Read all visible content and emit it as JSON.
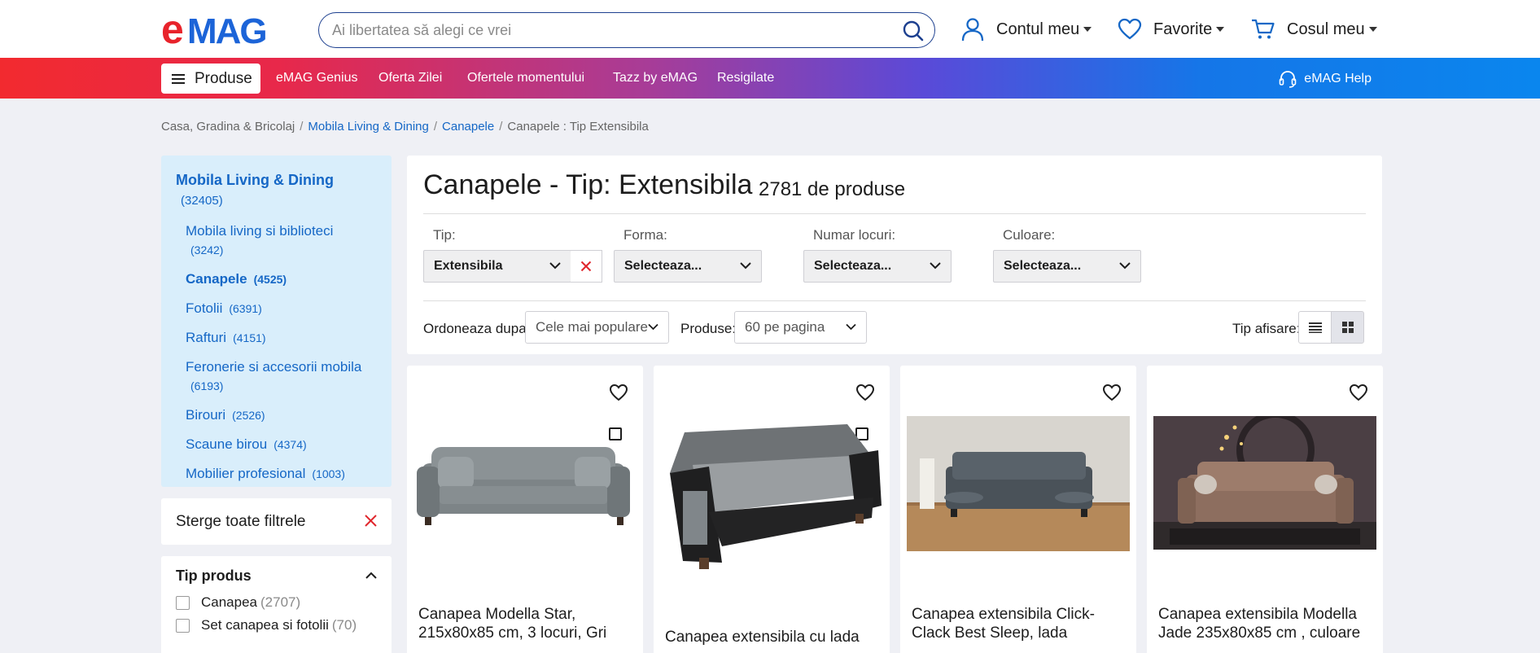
{
  "header": {
    "logo_text": "eMAG",
    "search_placeholder": "Ai libertatea să alegi ce vrei",
    "account_label": "Contul meu",
    "favorites_label": "Favorite",
    "cart_label": "Cosul meu"
  },
  "nav": {
    "products_label": "Produse",
    "links": [
      "eMAG Genius",
      "Oferta Zilei",
      "Ofertele momentului",
      "Tazz by eMAG",
      "Resigilate"
    ],
    "help_label": "eMAG Help"
  },
  "breadcrumb": {
    "items": [
      "Casa, Gradina & Bricolaj",
      "Mobila Living & Dining",
      "Canapele",
      "Canapele : Tip Extensibila"
    ],
    "separator": "/"
  },
  "sidebar": {
    "main_category": "Mobila Living & Dining",
    "main_count": "(32405)",
    "categories": [
      {
        "label": "Mobila living si biblioteci",
        "count": "(3242)"
      },
      {
        "label": "Canapele",
        "count": "(4525)"
      },
      {
        "label": "Fotolii",
        "count": "(6391)"
      },
      {
        "label": "Rafturi",
        "count": "(4151)"
      },
      {
        "label": "Feronerie si accesorii mobila",
        "count": "(6193)"
      },
      {
        "label": "Birouri",
        "count": "(2526)"
      },
      {
        "label": "Scaune birou",
        "count": "(4374)"
      },
      {
        "label": "Mobilier profesional",
        "count": "(1003)"
      }
    ],
    "clear_filters": "Sterge toate filtrele",
    "facet": {
      "title": "Tip produs",
      "options": [
        {
          "label": "Canapea",
          "count": "(2707)"
        },
        {
          "label": "Set canapea si fotolii",
          "count": "(70)"
        }
      ]
    }
  },
  "listing": {
    "title": "Canapele - Tip: Extensibila",
    "count": "2781 de produse",
    "filters": [
      {
        "label": "Tip:",
        "value": "Extensibila"
      },
      {
        "label": "Forma:",
        "value": "Selecteaza..."
      },
      {
        "label": "Numar locuri:",
        "value": "Selecteaza..."
      },
      {
        "label": "Culoare:",
        "value": "Selecteaza..."
      }
    ],
    "sort_label": "Ordoneaza dupa:",
    "sort_value": "Cele mai populare",
    "per_page_label": "Produse:",
    "per_page_value": "60 pe pagina",
    "view_label": "Tip afisare:"
  },
  "products": [
    {
      "title": "Canapea Modella Star, 215x80x85 cm, 3 locuri, Gri"
    },
    {
      "title": "Canapea extensibila cu lada"
    },
    {
      "title": "Canapea extensibila Click-Clack Best Sleep, lada"
    },
    {
      "title": "Canapea extensibila Modella Jade 235x80x85 cm , culoare"
    }
  ],
  "colors": {
    "brand_blue": "#1567c6",
    "brand_red": "#f22a2f",
    "sidebar_bg": "#d9eefb",
    "page_bg": "#eff0f5"
  }
}
